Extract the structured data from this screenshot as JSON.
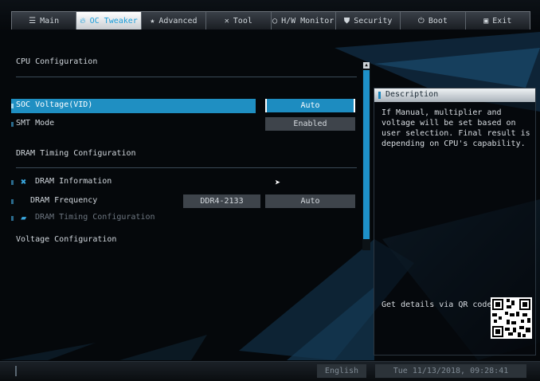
{
  "tabs": [
    {
      "label": "Main",
      "icon": "list-icon",
      "active": false
    },
    {
      "label": "OC Tweaker",
      "icon": "flame-icon",
      "active": true
    },
    {
      "label": "Advanced",
      "icon": "star-icon",
      "active": false
    },
    {
      "label": "Tool",
      "icon": "tools-icon",
      "active": false
    },
    {
      "label": "H/W Monitor",
      "icon": "monitor-icon",
      "active": false
    },
    {
      "label": "Security",
      "icon": "shield-icon",
      "active": false
    },
    {
      "label": "Boot",
      "icon": "power-icon",
      "active": false
    },
    {
      "label": "Exit",
      "icon": "exit-icon",
      "active": false
    }
  ],
  "main": {
    "cpu_heading": "CPU Configuration",
    "soc_voltage": {
      "label": "SOC Voltage(VID)",
      "value": "Auto"
    },
    "smt_mode": {
      "label": "SMT Mode",
      "value": "Enabled"
    },
    "dram_timing_heading": "DRAM Timing Configuration",
    "dram_information": "DRAM Information",
    "dram_frequency": {
      "label": "DRAM Frequency",
      "current": "DDR4-2133",
      "value": "Auto"
    },
    "dram_timing_sub": "DRAM Timing Configuration",
    "voltage_heading": "Voltage Configuration"
  },
  "description": {
    "title": "Description",
    "text": "If Manual, multiplier and voltage will be set based on user selection. Final result is depending on CPU's capability.",
    "qr_label": "Get details via QR code"
  },
  "bottom": {
    "language": "English",
    "datetime": "Tue 11/13/2018, 09:28:41"
  },
  "colors": {
    "accent": "#1d8cc0",
    "background": "#05080b"
  }
}
